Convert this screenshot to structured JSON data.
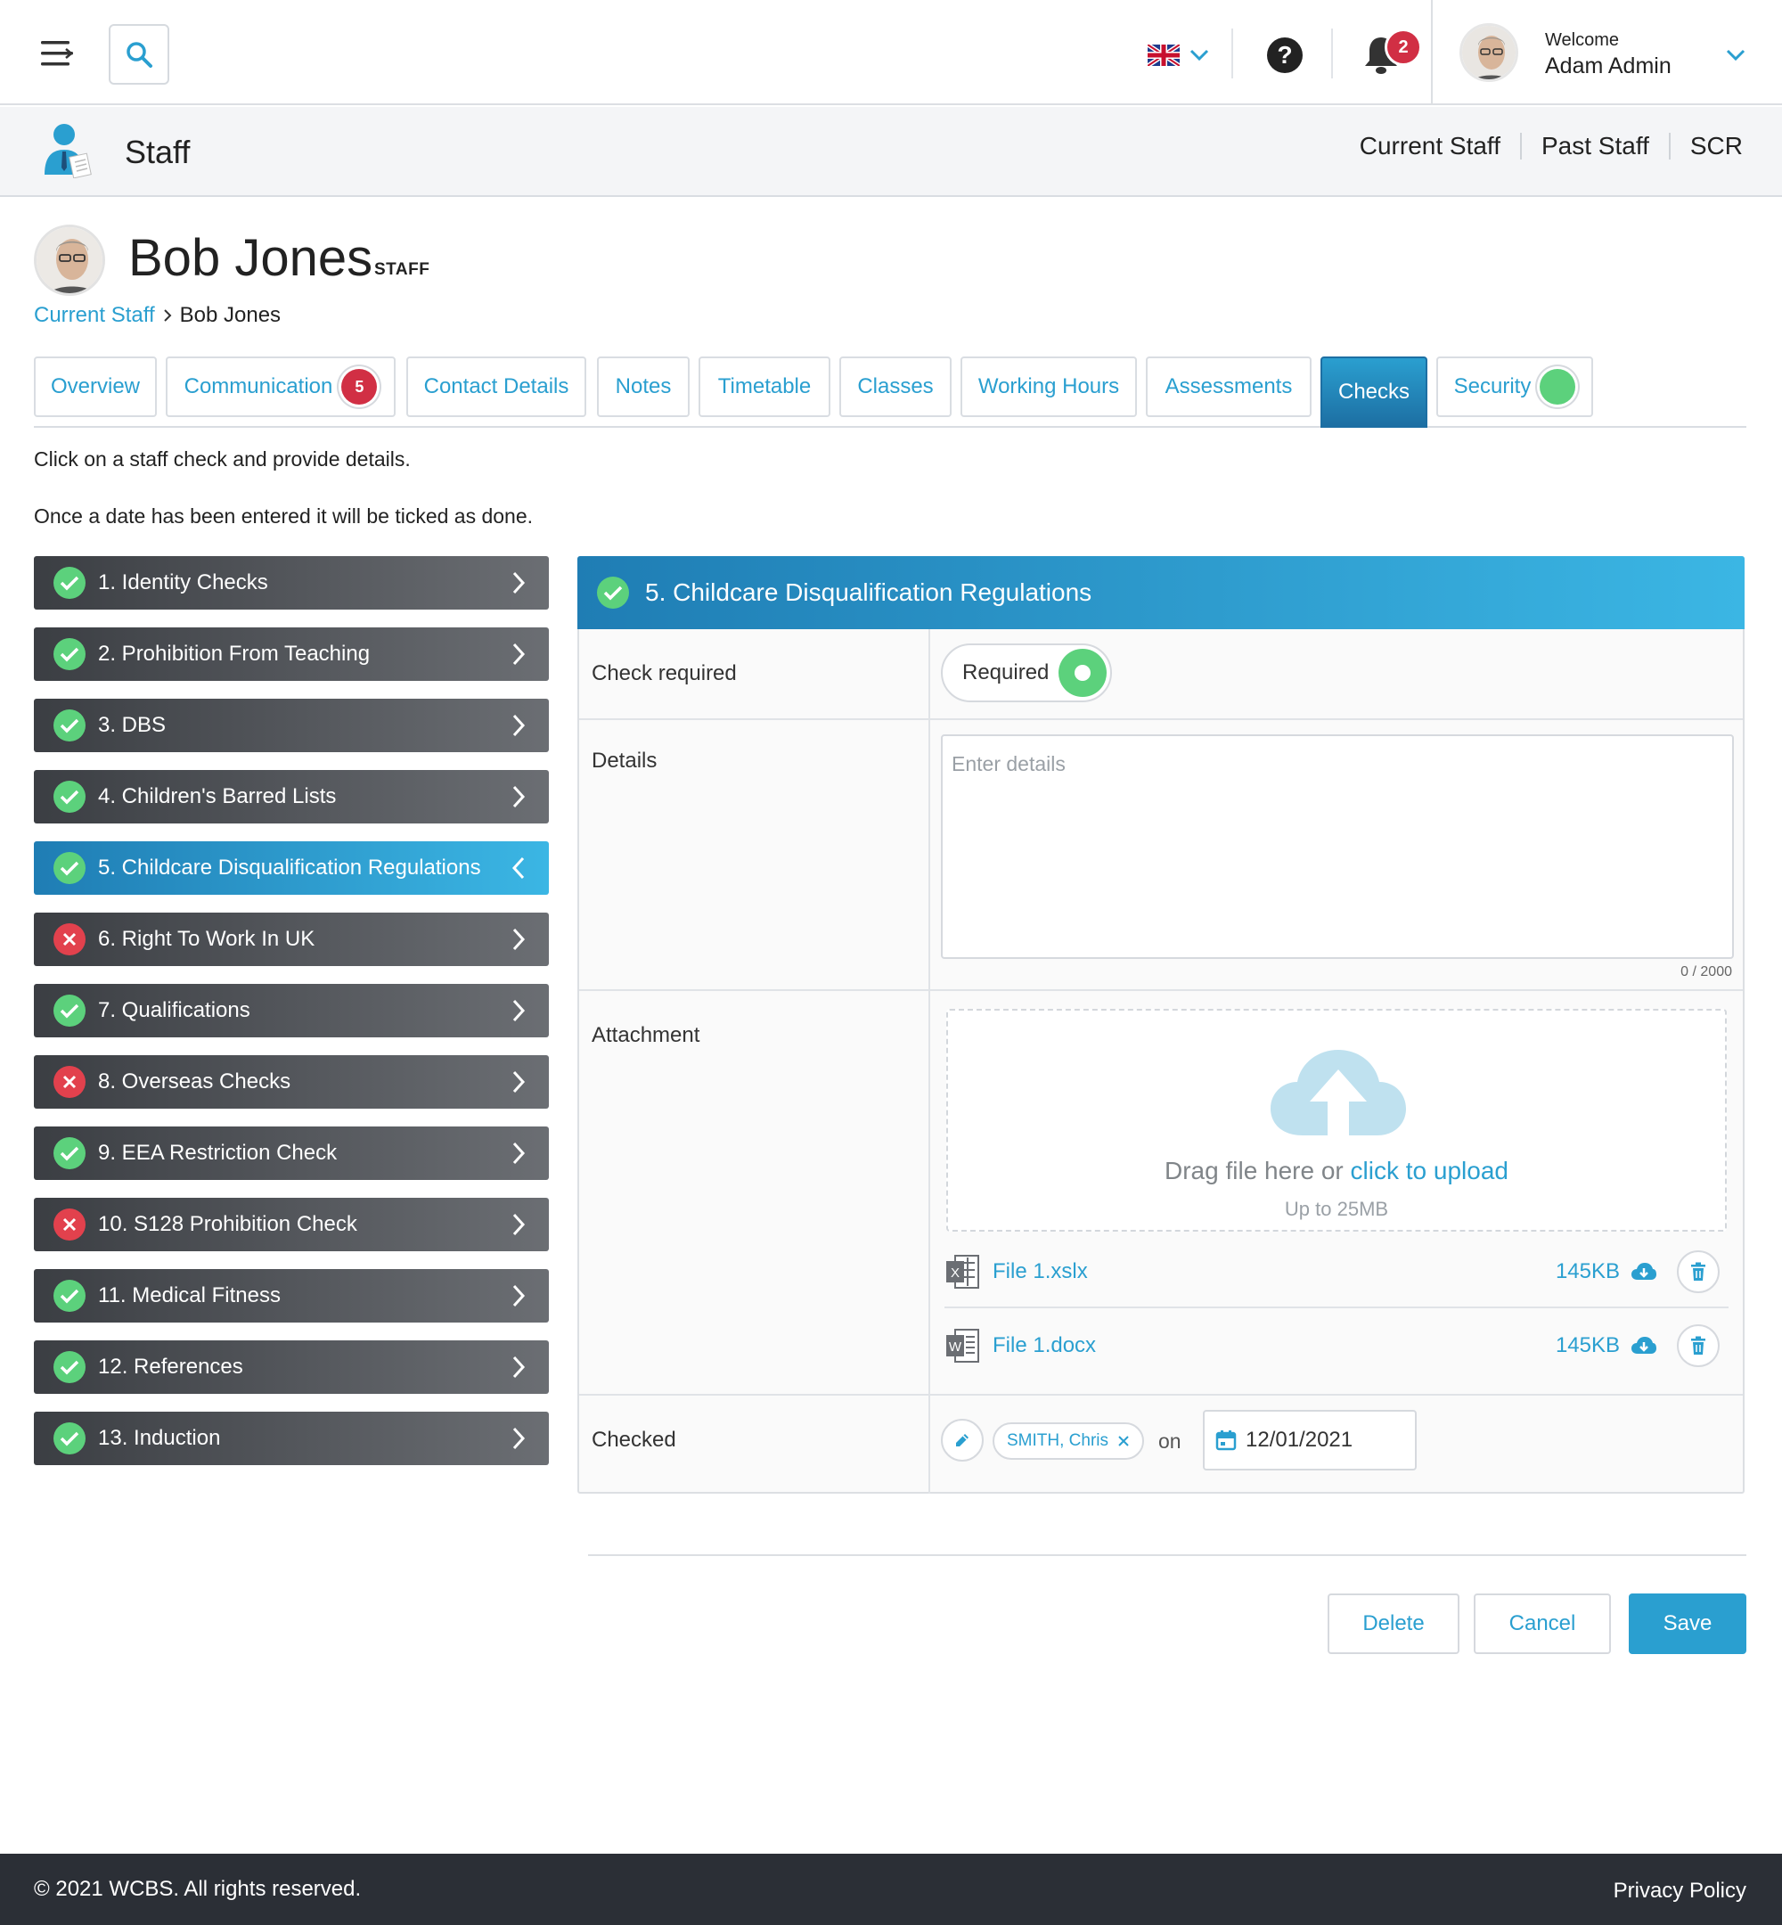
{
  "topbar": {
    "notification_count": "2",
    "welcome": "Welcome",
    "username": "Adam Admin"
  },
  "section": {
    "title": "Staff",
    "nav": [
      "Current Staff",
      "Past Staff",
      "SCR"
    ]
  },
  "profile": {
    "name": "Bob Jones",
    "role": "STAFF",
    "breadcrumb": {
      "parent": "Current Staff",
      "current": "Bob Jones"
    }
  },
  "tabs": [
    {
      "label": "Overview"
    },
    {
      "label": "Communication",
      "badge": "5"
    },
    {
      "label": "Contact Details"
    },
    {
      "label": "Notes"
    },
    {
      "label": "Timetable"
    },
    {
      "label": "Classes"
    },
    {
      "label": "Working Hours"
    },
    {
      "label": "Assessments"
    },
    {
      "label": "Checks",
      "active": true
    },
    {
      "label": "Security",
      "status_color": "#5cd17c"
    }
  ],
  "intro": {
    "line1": "Click on a staff check and provide details.",
    "line2": "Once a date has been entered it will be ticked as done."
  },
  "checks": [
    {
      "label": "1. Identity Checks",
      "status": "ok"
    },
    {
      "label": "2. Prohibition From Teaching",
      "status": "ok"
    },
    {
      "label": "3. DBS",
      "status": "ok"
    },
    {
      "label": "4. Children's Barred Lists",
      "status": "ok"
    },
    {
      "label": "5. Childcare Disqualification Regulations",
      "status": "ok",
      "active": true
    },
    {
      "label": "6. Right To Work In UK",
      "status": "fail"
    },
    {
      "label": "7. Qualifications",
      "status": "ok"
    },
    {
      "label": "8. Overseas Checks",
      "status": "fail"
    },
    {
      "label": "9. EEA Restriction Check",
      "status": "ok"
    },
    {
      "label": "10. S128 Prohibition Check",
      "status": "fail"
    },
    {
      "label": "11. Medical Fitness",
      "status": "ok"
    },
    {
      "label": "12. References",
      "status": "ok"
    },
    {
      "label": "13. Induction",
      "status": "ok"
    }
  ],
  "detail": {
    "title": "5. Childcare Disqualification Regulations",
    "check_required_label": "Check required",
    "toggle_text": "Required",
    "details_label": "Details",
    "details_placeholder": "Enter details",
    "details_counter": "0 / 2000",
    "attachment_label": "Attachment",
    "drop_text": "Drag file here or ",
    "drop_link": "click to upload",
    "drop_sub": "Up to 25MB",
    "files": [
      {
        "name": "File 1.xslx",
        "size": "145KB",
        "type": "X"
      },
      {
        "name": "File 1.docx",
        "size": "145KB",
        "type": "W"
      }
    ],
    "checked_label": "Checked",
    "checked_by": "SMITH, Chris",
    "on_text": "on",
    "checked_date": "12/01/2021"
  },
  "actions": {
    "delete": "Delete",
    "cancel": "Cancel",
    "save": "Save"
  },
  "footer": {
    "copyright": "© 2021 WCBS.  All rights reserved.",
    "privacy": "Privacy Policy"
  },
  "colors": {
    "accent": "#2a9fd0",
    "success": "#5cd17c",
    "danger": "#e2414d",
    "badge": "#d12f44"
  }
}
